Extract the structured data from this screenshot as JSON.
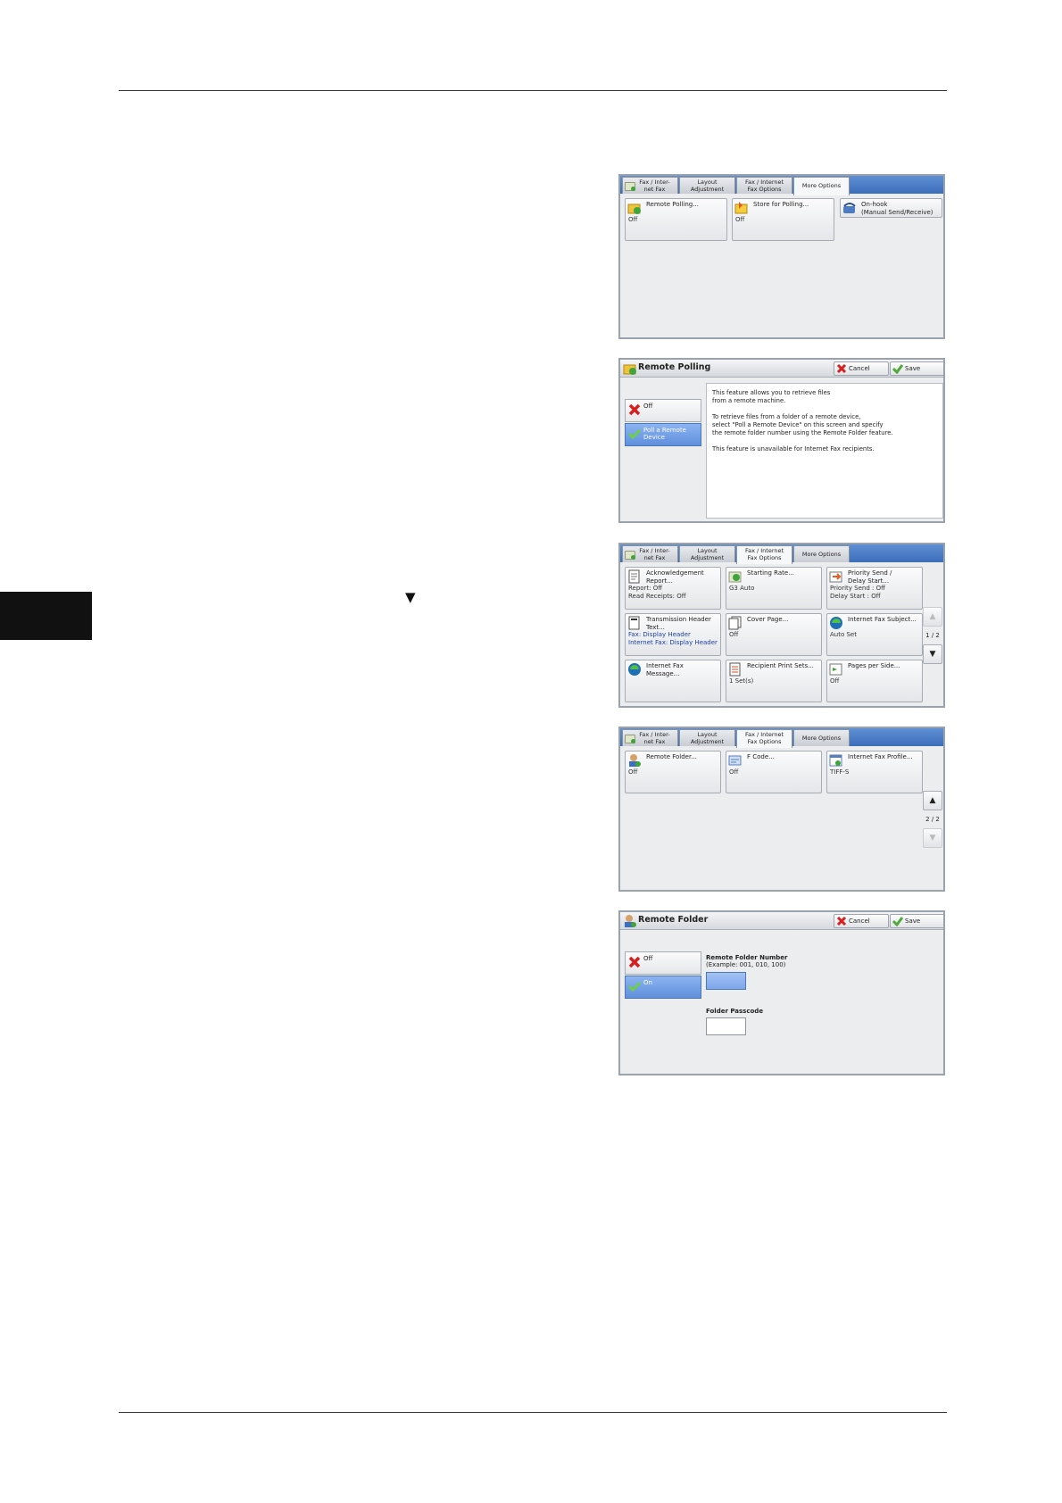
{
  "tabs": {
    "fax": [
      "Fax / Inter-",
      "net Fax"
    ],
    "layout": [
      "Layout",
      "Adjustment"
    ],
    "options": [
      "Fax / Internet",
      "Fax Options"
    ],
    "more": "More Options"
  },
  "screen1": {
    "remote_polling": {
      "title": "Remote Polling...",
      "value": "Off"
    },
    "store_for_polling": {
      "title": "Store for Polling...",
      "value": "Off"
    },
    "onhook": {
      "title": [
        "On-hook",
        "(Manual Send/Receive)"
      ]
    }
  },
  "screen2": {
    "title": "Remote Polling",
    "cancel": "Cancel",
    "save": "Save",
    "opt_off": "Off",
    "opt_poll": [
      "Poll a Remote",
      "Device"
    ],
    "info": [
      [
        "This feature allows you to retrieve files",
        "from a remote machine."
      ],
      [
        "To retrieve files from a folder of a remote device,",
        "select \"Poll a Remote Device\" on this screen and specify",
        "the remote folder number using the Remote Folder feature."
      ],
      [
        "This feature is unavailable for Internet Fax recipients."
      ]
    ]
  },
  "screen3": {
    "ack": {
      "title": [
        "Acknowledgement",
        "Report..."
      ],
      "values": [
        "Report: Off",
        "Read Receipts: Off"
      ]
    },
    "starting_rate": {
      "title": "Starting Rate...",
      "value": "G3 Auto"
    },
    "priority": {
      "title": [
        "Priority Send /",
        "Delay Start..."
      ],
      "values": [
        "Priority Send : Off",
        "Delay Start : Off"
      ]
    },
    "tx_header": {
      "title": [
        "Transmission Header",
        "Text..."
      ],
      "values": [
        "Fax: Display Header",
        "Internet Fax: Display Header"
      ]
    },
    "cover_page": {
      "title": "Cover Page...",
      "value": "Off"
    },
    "ifax_subject": {
      "title": "Internet Fax Subject...",
      "value": "Auto Set"
    },
    "ifax_message": {
      "title": [
        "Internet Fax",
        "Message..."
      ]
    },
    "recipient_sets": {
      "title": "Recipient Print Sets...",
      "value": "1 Set(s)"
    },
    "pages_per_side": {
      "title": "Pages per Side...",
      "value": "Off"
    },
    "page": "1 / 2"
  },
  "screen4": {
    "remote_folder": {
      "title": "Remote Folder...",
      "value": "Off"
    },
    "fcode": {
      "title": "F Code...",
      "value": "Off"
    },
    "ifax_profile": {
      "title": "Internet Fax Profile...",
      "value": "TIFF-S"
    },
    "page": "2 / 2"
  },
  "screen5": {
    "title": "Remote Folder",
    "cancel": "Cancel",
    "save": "Save",
    "opt_off": "Off",
    "opt_on": "On",
    "folder_number_label": "Remote Folder Number",
    "folder_number_example": "(Example: 001, 010, 100)",
    "folder_passcode_label": "Folder Passcode"
  }
}
